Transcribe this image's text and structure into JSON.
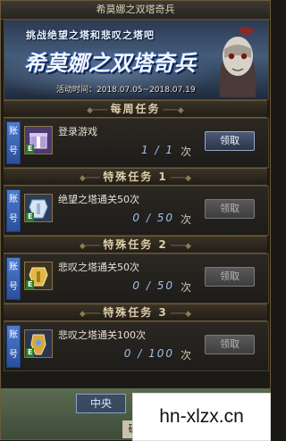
{
  "window_title": "希莫娜之双塔奇兵",
  "banner": {
    "tagline": "挑战绝望之塔和悲叹之塔吧",
    "title": "希莫娜之双塔奇兵",
    "date_label": "活动时间：2018.07.05~2018.07.19"
  },
  "sections": [
    {
      "header": "每周任务",
      "task": "登录游戏",
      "progress": "1 / 1",
      "unit": "次",
      "button": "领取",
      "button_enabled": true,
      "account_label": "账号",
      "item_badge": "E"
    },
    {
      "header": "特殊任务 1",
      "task": "绝望之塔通关50次",
      "progress": "0 / 50",
      "unit": "次",
      "button": "领取",
      "button_enabled": false,
      "account_label": "账号",
      "item_badge": "E"
    },
    {
      "header": "特殊任务 2",
      "task": "悲叹之塔通关50次",
      "progress": "0 / 50",
      "unit": "次",
      "button": "领取",
      "button_enabled": false,
      "account_label": "账号",
      "item_badge": "E"
    },
    {
      "header": "特殊任务 3",
      "task": "悲叹之塔通关100次",
      "progress": "0 / 100",
      "unit": "次",
      "button": "领取",
      "button_enabled": false,
      "account_label": "账号",
      "item_badge": "E"
    }
  ],
  "background": {
    "center_label": "中央",
    "confirm_label": "确"
  },
  "watermark": "hn-xlzx.cn",
  "colors": {
    "accent_blue": "#4e7cd0",
    "frame_gold": "#6e5b3c"
  }
}
